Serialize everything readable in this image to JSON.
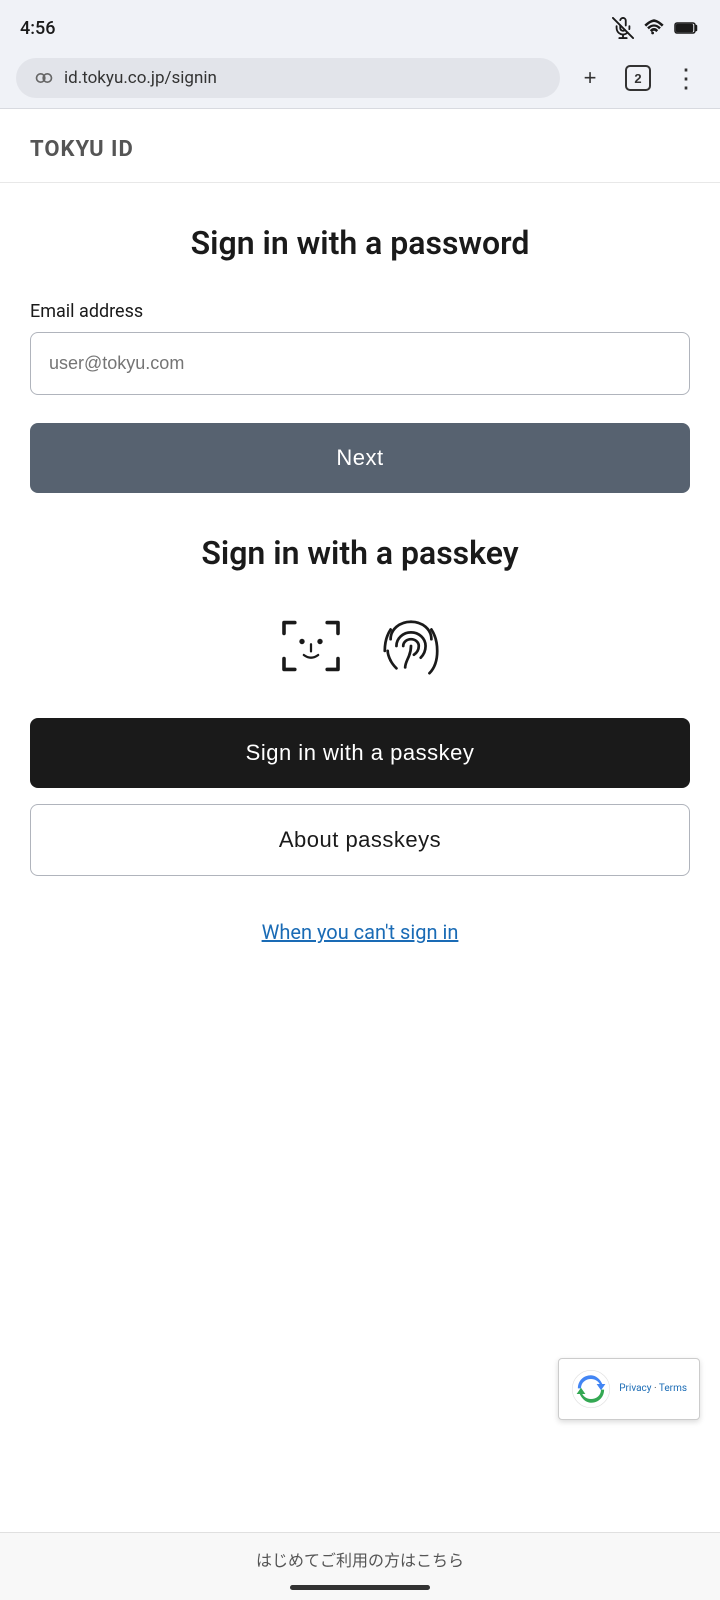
{
  "status_bar": {
    "time": "4:56",
    "mute_icon": "🔇",
    "wifi_icon": "wifi",
    "battery_icon": "battery"
  },
  "browser": {
    "url": "id.tokyu.co.jp/signin",
    "tab_count": "2",
    "add_label": "+",
    "menu_label": "⋮"
  },
  "brand": {
    "title": "TOKYU ID"
  },
  "password_section": {
    "heading": "Sign in with a password",
    "email_label": "Email address",
    "email_placeholder": "user@tokyu.com",
    "next_button": "Next"
  },
  "passkey_section": {
    "heading": "Sign in with a passkey",
    "sign_in_button": "Sign in with a passkey",
    "about_button": "About passkeys"
  },
  "help": {
    "link_text": "When you can't sign in"
  },
  "recaptcha": {
    "privacy_text": "Privacy",
    "terms_text": "Terms"
  },
  "footer": {
    "text": "はじめてご利用の方はこちら"
  }
}
